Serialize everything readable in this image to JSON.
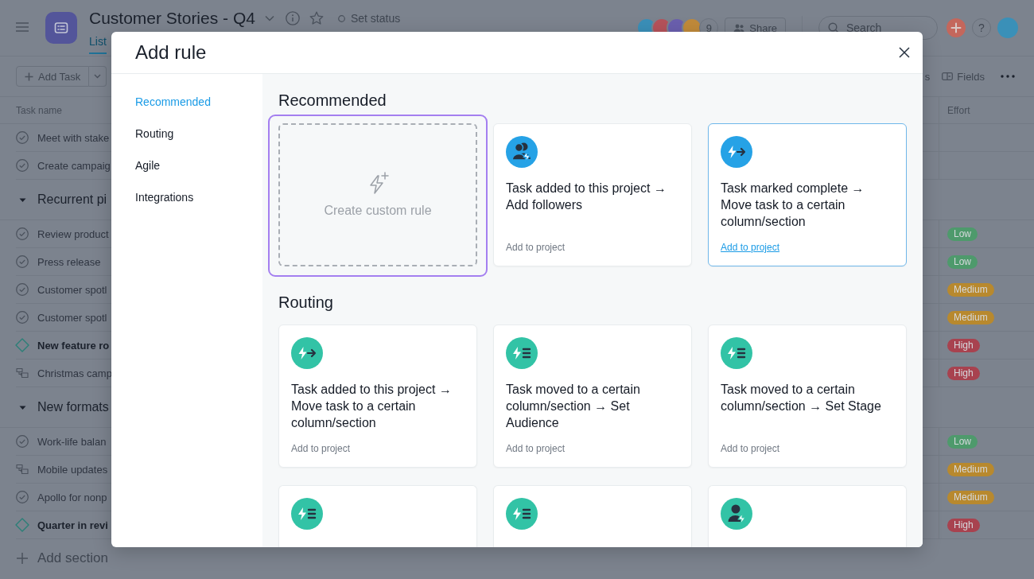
{
  "app": {
    "header": {
      "title": "Customer Stories - Q4",
      "status": "Set status",
      "tabs": [
        {
          "label": "List",
          "selected": true
        }
      ],
      "members": [
        {
          "color": "#3a8fb8"
        },
        {
          "color": "#b5525a"
        },
        {
          "color": "#6a5fae"
        },
        {
          "color": "#c08a3a"
        }
      ],
      "member_count": "9",
      "share": "Share",
      "search": {
        "placeholder": "Search"
      },
      "help": "?",
      "user": {
        "color": "#3a90b8"
      }
    },
    "toolbar": {
      "add_task": "Add Task",
      "buttons": [
        {
          "kind": "text",
          "label": "s"
        },
        {
          "kind": "fields",
          "label": "Fields"
        }
      ]
    },
    "table": {
      "columns": [
        "Task name",
        "Effort"
      ],
      "sections": [
        {
          "tasks": [
            {
              "kind": "task",
              "name": "Meet with stake"
            },
            {
              "kind": "task",
              "name": "Create campaig"
            }
          ]
        },
        {
          "name": "Recurrent pi",
          "expanded": true,
          "tasks": [
            {
              "kind": "task",
              "name": "Review product",
              "effort": {
                "label": "Low",
                "color": "#4e9a6c"
              }
            },
            {
              "kind": "task",
              "name": "Press release",
              "effort": {
                "label": "Low",
                "color": "#4e9a6c"
              }
            },
            {
              "kind": "task",
              "name": "Customer spotl",
              "effort": {
                "label": "Medium",
                "color": "#b8892e"
              }
            },
            {
              "kind": "task",
              "name": "Customer spotl",
              "effort": {
                "label": "Medium",
                "color": "#b8892e"
              }
            },
            {
              "kind": "milestone",
              "name": "New feature ro",
              "effort": {
                "label": "High",
                "color": "#a8424f"
              }
            },
            {
              "kind": "linked",
              "name": "Christmas camp",
              "effort": {
                "label": "High",
                "color": "#a8424f"
              }
            }
          ]
        },
        {
          "name": "New formats",
          "expanded": true,
          "tasks": [
            {
              "kind": "task",
              "name": "Work-life balan",
              "effort": {
                "label": "Low",
                "color": "#4e9a6c"
              }
            },
            {
              "kind": "linked",
              "name": "Mobile updates",
              "effort": {
                "label": "Medium",
                "color": "#b8892e"
              }
            },
            {
              "kind": "task",
              "name": "Apollo for nonp",
              "effort": {
                "label": "Medium",
                "color": "#b8892e"
              }
            },
            {
              "kind": "milestone",
              "name": "Quarter in revi",
              "effort": {
                "label": "High",
                "color": "#a8424f"
              }
            }
          ]
        }
      ]
    },
    "add_section": "Add section"
  },
  "dialog": {
    "title": "Add rule",
    "nav": [
      {
        "label": "Recommended",
        "selected": true
      },
      {
        "label": "Routing",
        "selected": false
      },
      {
        "label": "Agile",
        "selected": false
      },
      {
        "label": "Integrations",
        "selected": false
      }
    ],
    "groups": [
      {
        "heading": "Recommended",
        "cards": [
          {
            "kind": "custom",
            "label": "Create custom rule",
            "focused": true
          },
          {
            "kind": "add-followers",
            "color": "#26a2e6",
            "title": "Task added to this project → Add followers",
            "link": "Add to project",
            "hovered": false
          },
          {
            "kind": "move-section",
            "color": "#26a2e6",
            "title": "Task marked complete → Move task to a certain column/section",
            "link": "Add to project",
            "hovered": true
          }
        ]
      },
      {
        "heading": "Routing",
        "cards": [
          {
            "kind": "move-section",
            "color": "#32c3a6",
            "title": "Task added to this project → Move task to a certain column/section",
            "link": "Add to project",
            "hovered": false
          },
          {
            "kind": "set-field",
            "color": "#32c3a6",
            "title": "Task moved to a certain column/section → Set Audience",
            "link": "Add to project",
            "hovered": false
          },
          {
            "kind": "set-field",
            "color": "#32c3a6",
            "title": "Task moved to a certain column/section → Set Stage",
            "link": "Add to project",
            "hovered": false
          },
          {
            "kind": "set-field",
            "color": "#32c3a6",
            "hovered": false
          },
          {
            "kind": "set-field",
            "color": "#32c3a6",
            "hovered": false
          },
          {
            "kind": "assign",
            "color": "#32c3a6",
            "hovered": false
          }
        ]
      }
    ]
  }
}
